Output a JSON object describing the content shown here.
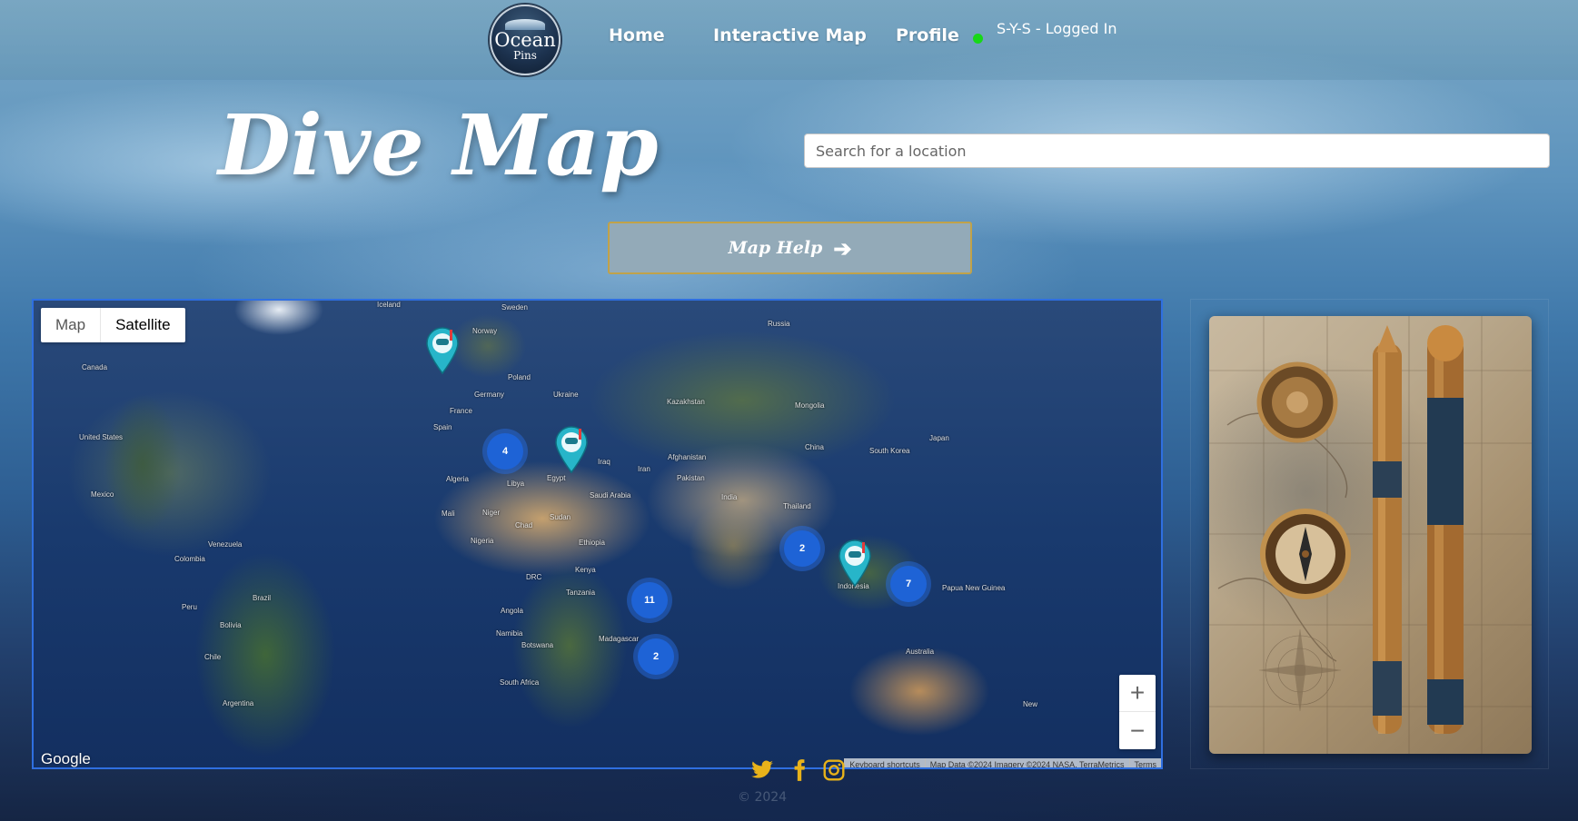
{
  "header": {
    "logo": {
      "line1": "Ocean",
      "line2": "Pins"
    },
    "nav": [
      {
        "label": "Home"
      },
      {
        "label": "Interactive Map"
      },
      {
        "label": "Profile"
      }
    ],
    "user_status": "S-Y-S - Logged In",
    "status_color": "#18d818"
  },
  "hero": {
    "title": "Dive Map",
    "search_placeholder": "Search for a location",
    "help_button": "Map Help",
    "help_icon": "arrow-right-icon"
  },
  "map": {
    "type_options": [
      "Map",
      "Satellite"
    ],
    "selected_type": "Satellite",
    "clusters": [
      "4",
      "2",
      "7",
      "11",
      "2"
    ],
    "pins": [
      "dive-pin",
      "dive-pin",
      "dive-pin"
    ],
    "labels": [
      "Iceland",
      "Sweden",
      "Norway",
      "Russia",
      "Canada",
      "Poland",
      "Germany",
      "Ukraine",
      "France",
      "Spain",
      "Kazakhstan",
      "Mongolia",
      "United States",
      "China",
      "South Korea",
      "Japan",
      "Iraq",
      "Iran",
      "Afghanistan",
      "Pakistan",
      "Algeria",
      "Libya",
      "Egypt",
      "Saudi Arabia",
      "India",
      "Thailand",
      "Mexico",
      "Mali",
      "Niger",
      "Chad",
      "Sudan",
      "Ethiopia",
      "Venezuela",
      "Colombia",
      "Nigeria",
      "Kenya",
      "DRC",
      "Tanzania",
      "Indonesia",
      "Papua New Guinea",
      "Peru",
      "Brazil",
      "Bolivia",
      "Angola",
      "Namibia",
      "Botswana",
      "Madagascar",
      "Australia",
      "Chile",
      "South Africa",
      "Argentina",
      "New"
    ],
    "zoom_in": "+",
    "zoom_out": "−",
    "google": "Google",
    "attribution": [
      "Keyboard shortcuts",
      "Map Data ©2024 Imagery ©2024 NASA, TerraMetrics",
      "Terms"
    ]
  },
  "footer": {
    "social": [
      "twitter-icon",
      "facebook-icon",
      "instagram-icon"
    ],
    "icon_color": "#e8b21a",
    "copyright": "© 2024"
  }
}
